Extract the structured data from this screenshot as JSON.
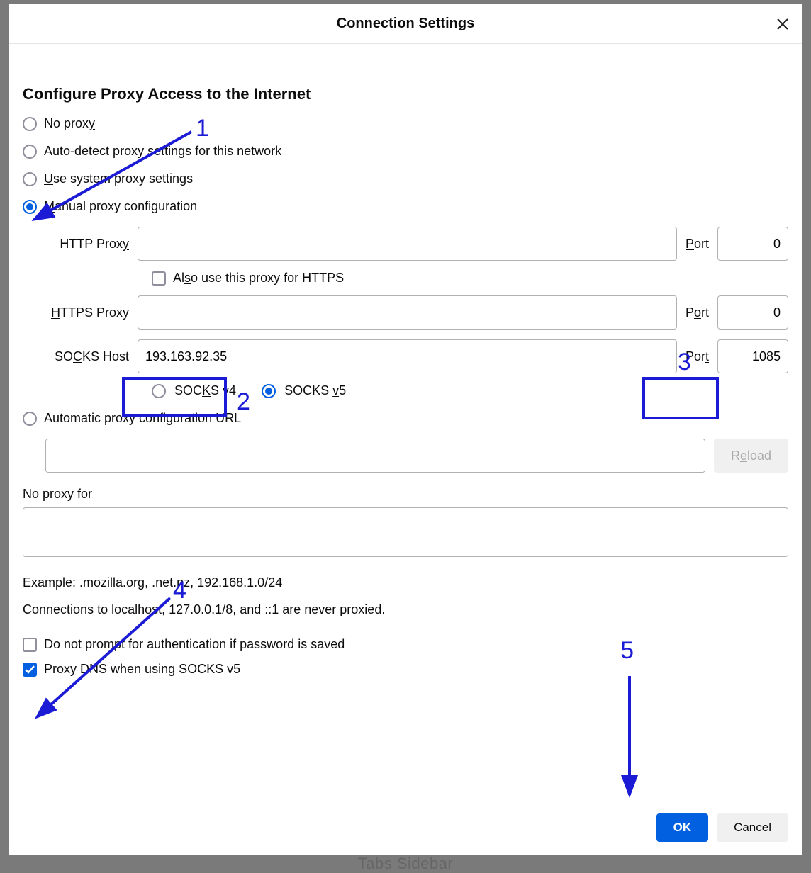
{
  "dialog": {
    "title": "Connection Settings",
    "section_heading": "Configure Proxy Access to the Internet"
  },
  "radios": {
    "no_proxy": "No prox",
    "no_proxy_u": "y",
    "auto_detect_pre": "Auto-detect proxy settings for this net",
    "auto_detect_u": "w",
    "auto_detect_post": "ork",
    "system_pre": "",
    "system_u": "U",
    "system_post": "se system proxy settings",
    "manual_pre": "",
    "manual_u": "M",
    "manual_post": "anual proxy configuration",
    "auto_url_pre": "",
    "auto_url_u": "A",
    "auto_url_post": "utomatic proxy configuration URL"
  },
  "fields": {
    "http_label": "HTTP Prox",
    "http_label_u": "y",
    "http_value": "",
    "http_port_label_pre": "",
    "http_port_label_u": "P",
    "http_port_label_post": "ort",
    "http_port": "0",
    "also_https_pre": "Al",
    "also_https_u": "s",
    "also_https_post": "o use this proxy for HTTPS",
    "https_label_pre": "",
    "https_label_u": "H",
    "https_label_post": "TTPS Proxy",
    "https_value": "",
    "https_port_label_pre": "P",
    "https_port_label_u": "o",
    "https_port_label_post": "rt",
    "https_port": "0",
    "socks_label_pre": "SO",
    "socks_label_u": "C",
    "socks_label_post": "KS Host",
    "socks_value": "193.163.92.35",
    "socks_port_label_pre": "Por",
    "socks_port_label_u": "t",
    "socks_port_label_post": "",
    "socks_port": "1085",
    "socks_v4_pre": "SOC",
    "socks_v4_u": "K",
    "socks_v4_post": "S v4",
    "socks_v5_pre": "SOCKS ",
    "socks_v5_u": "v",
    "socks_v5_post": "5",
    "reload_pre": "R",
    "reload_u": "e",
    "reload_post": "load",
    "noproxy_label_pre": "",
    "noproxy_label_u": "N",
    "noproxy_label_post": "o proxy for",
    "example": "Example: .mozilla.org, .net.nz, 192.168.1.0/24",
    "never_proxied": "Connections to localhost, 127.0.0.1/8, and ::1 are never proxied.",
    "no_prompt_pre": "Do not prompt for authent",
    "no_prompt_u": "i",
    "no_prompt_post": "cation if password is saved",
    "proxy_dns_pre": "Proxy ",
    "proxy_dns_u": "D",
    "proxy_dns_post": "NS when using SOCKS v5"
  },
  "footer": {
    "ok": "OK",
    "cancel": "Cancel"
  },
  "annotations": {
    "n1": "1",
    "n2": "2",
    "n3": "3",
    "n4": "4",
    "n5": "5"
  },
  "background_text": "Tabs Sidebar"
}
